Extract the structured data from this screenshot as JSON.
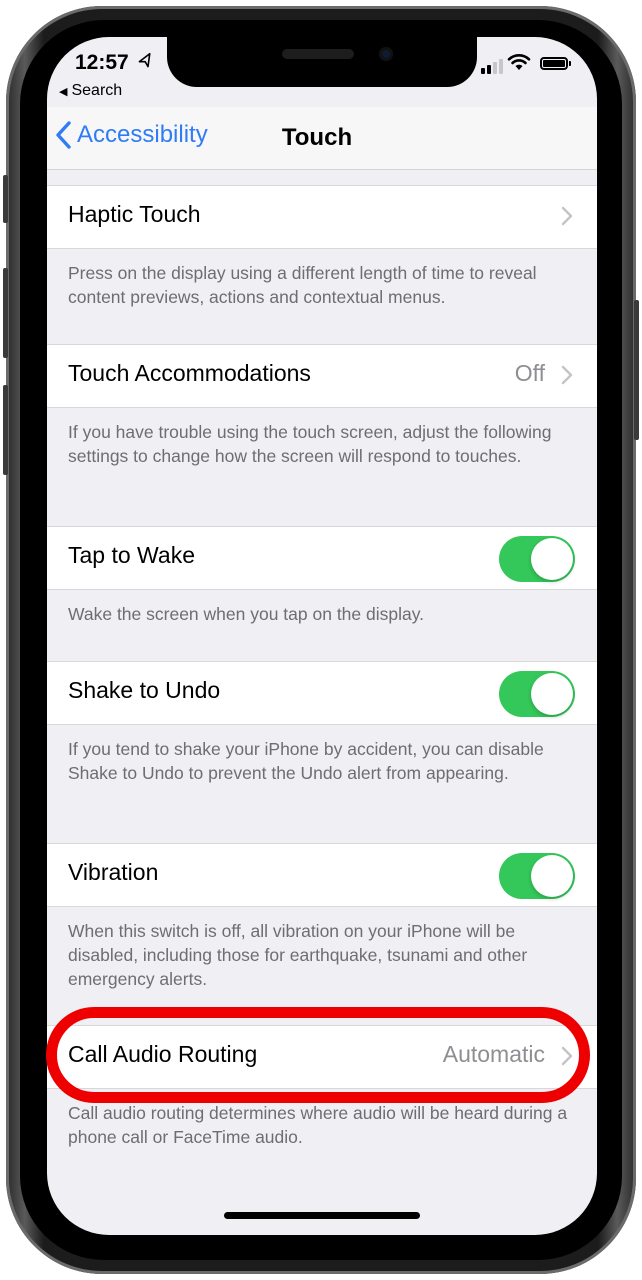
{
  "status_bar": {
    "time": "12:57",
    "location_icon": "location-arrow-icon",
    "back_app_label": "Search",
    "signal_bars_active": 2,
    "signal_bars_total": 4,
    "wifi_icon": "wifi-icon",
    "battery_icon": "battery-icon"
  },
  "navbar": {
    "back_label": "Accessibility",
    "title": "Touch"
  },
  "rows": [
    {
      "label": "Haptic Touch",
      "value": "",
      "control": "chevron",
      "footer": "Press on the display using a different length of time to reveal content previews, actions and contextual menus."
    },
    {
      "label": "Touch Accommodations",
      "value": "Off",
      "control": "chevron",
      "footer": "If you have trouble using the touch screen, adjust the following settings to change how the screen will respond to touches."
    },
    {
      "label": "Tap to Wake",
      "value": "",
      "control": "toggle",
      "on": true,
      "footer": "Wake the screen when you tap on the display."
    },
    {
      "label": "Shake to Undo",
      "value": "",
      "control": "toggle",
      "on": true,
      "footer": "If you tend to shake your iPhone by accident, you can disable Shake to Undo to prevent the Undo alert from appearing."
    },
    {
      "label": "Vibration",
      "value": "",
      "control": "toggle",
      "on": true,
      "footer": "When this switch is off, all vibration on your iPhone will be disabled, including those for earthquake, tsunami and other emergency alerts."
    },
    {
      "label": "Call Audio Routing",
      "value": "Automatic",
      "control": "chevron",
      "footer": "Call audio routing determines where audio will be heard during a phone call or FaceTime audio."
    }
  ],
  "annotation": {
    "highlighted_row": "Call Audio Routing",
    "color": "#ee0000"
  },
  "colors": {
    "accent": "#2f7cf6",
    "toggle_on": "#34c759",
    "background": "#efeff4"
  }
}
